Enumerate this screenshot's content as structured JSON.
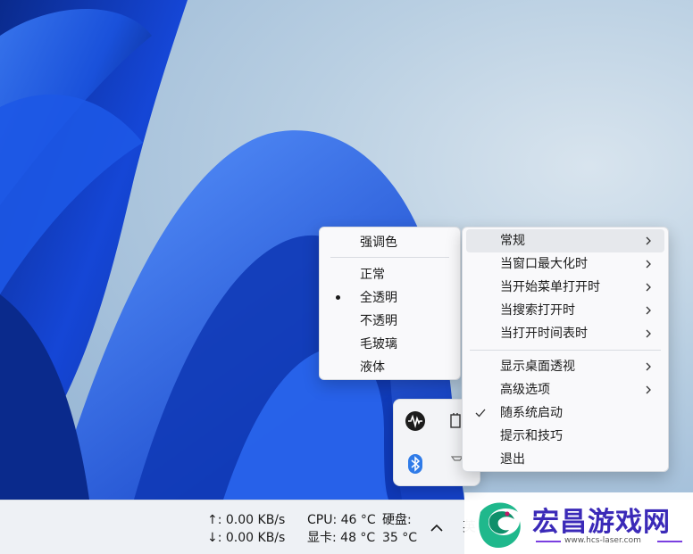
{
  "taskbar": {
    "upload": "↑: 0.00 KB/s",
    "download": "↓: 0.00 KB/s",
    "cpu": "CPU: 46 °C",
    "gpu": "显卡: 48 °C",
    "disk_label": "硬盘:",
    "disk_temp": "35 °C",
    "partial_glyph": "英"
  },
  "watermark": {
    "title": "宏昌游戏网",
    "url": "www.hcs-laser.com"
  },
  "left_menu": {
    "items": [
      {
        "label": "强调色",
        "state": "header"
      },
      {
        "label": "正常",
        "state": "none"
      },
      {
        "label": "全透明",
        "state": "selected"
      },
      {
        "label": "不透明",
        "state": "none"
      },
      {
        "label": "毛玻璃",
        "state": "none"
      },
      {
        "label": "液体",
        "state": "none"
      }
    ]
  },
  "right_menu": {
    "items": [
      {
        "label": "常规",
        "submenu": true,
        "highlighted": true
      },
      {
        "label": "当窗口最大化时",
        "submenu": true
      },
      {
        "label": "当开始菜单打开时",
        "submenu": true
      },
      {
        "label": "当搜索打开时",
        "submenu": true
      },
      {
        "label": "当打开时间表时",
        "submenu": true
      },
      {
        "label": "显示桌面透视",
        "submenu": true
      },
      {
        "label": "高级选项",
        "submenu": true
      },
      {
        "label": "随系统启动",
        "checked": true
      },
      {
        "label": "提示和技巧"
      },
      {
        "label": "退出"
      }
    ]
  },
  "tray": {
    "icons": [
      "audio-wave-icon",
      "bluetooth-icon"
    ]
  },
  "colors": {
    "bloom_dark": "#0a2a8c",
    "bloom_mid": "#1546d6",
    "bloom_light": "#3a78f0",
    "bluetooth": "#2f7be8",
    "watermark_purple": "#3b2ab8"
  }
}
